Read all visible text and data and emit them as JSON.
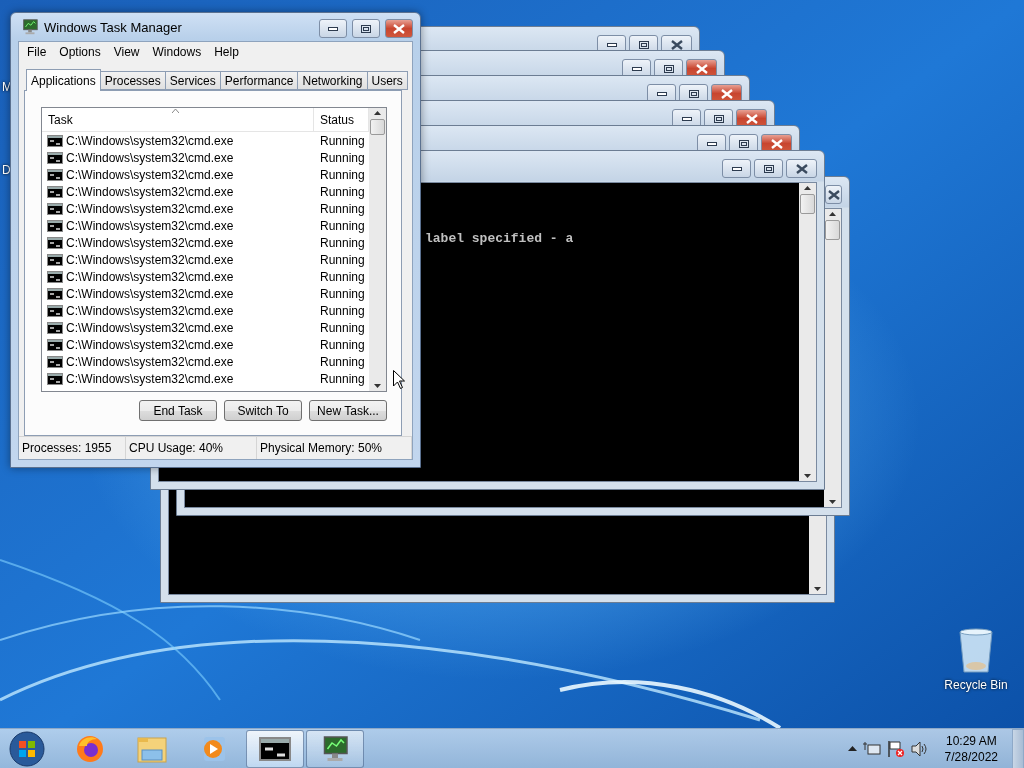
{
  "desktop_icons": [
    {
      "kind": "cut",
      "label": "M"
    },
    {
      "kind": "cut",
      "label": "D"
    },
    {
      "kind": "recycle_bin",
      "label": "Recycle Bin"
    }
  ],
  "console_windows": [
    {
      "close_highlighted": false
    },
    {
      "close_highlighted": false
    },
    {
      "close_highlighted": true
    },
    {
      "close_highlighted": true
    },
    {
      "close_highlighted": true
    },
    {
      "close_highlighted": true
    },
    {
      "close_highlighted": false,
      "text": "label specified - a"
    }
  ],
  "task_manager": {
    "title": "Windows Task Manager",
    "menu": [
      "File",
      "Options",
      "View",
      "Windows",
      "Help"
    ],
    "tabs": [
      {
        "label": "Applications",
        "selected": true
      },
      {
        "label": "Processes",
        "selected": false
      },
      {
        "label": "Services",
        "selected": false
      },
      {
        "label": "Performance",
        "selected": false
      },
      {
        "label": "Networking",
        "selected": false
      },
      {
        "label": "Users",
        "selected": false
      }
    ],
    "columns": [
      "Task",
      "Status"
    ],
    "rows": [
      {
        "task": "C:\\Windows\\system32\\cmd.exe",
        "status": "Running",
        "selected": false
      },
      {
        "task": "C:\\Windows\\system32\\cmd.exe",
        "status": "Running",
        "selected": false
      },
      {
        "task": "C:\\Windows\\system32\\cmd.exe",
        "status": "Running",
        "selected": false
      },
      {
        "task": "C:\\Windows\\system32\\cmd.exe",
        "status": "Running",
        "selected": false
      },
      {
        "task": "C:\\Windows\\system32\\cmd.exe",
        "status": "Running",
        "selected": false
      },
      {
        "task": "C:\\Windows\\system32\\cmd.exe",
        "status": "Running",
        "selected": false
      },
      {
        "task": "C:\\Windows\\system32\\cmd.exe",
        "status": "Running",
        "selected": false
      },
      {
        "task": "C:\\Windows\\system32\\cmd.exe",
        "status": "Running",
        "selected": false
      },
      {
        "task": "C:\\Windows\\system32\\cmd.exe",
        "status": "Running",
        "selected": false
      },
      {
        "task": "C:\\Windows\\system32\\cmd.exe",
        "status": "Running",
        "selected": false
      },
      {
        "task": "C:\\Windows\\system32\\cmd.exe",
        "status": "Running",
        "selected": false
      },
      {
        "task": "C:\\Windows\\system32\\cmd.exe",
        "status": "Running",
        "selected": false
      },
      {
        "task": "C:\\Windows\\system32\\cmd.exe",
        "status": "Running",
        "selected": false
      },
      {
        "task": "C:\\Windows\\system32\\cmd.exe",
        "status": "Running",
        "selected": false
      },
      {
        "task": "C:\\Windows\\system32\\cmd.exe",
        "status": "Running",
        "selected": false
      }
    ],
    "buttons": [
      "End Task",
      "Switch To",
      "New Task..."
    ],
    "status_bar": [
      "Processes: 1955",
      "CPU Usage: 40%",
      "Physical Memory: 50%"
    ]
  },
  "taskbar": {
    "items": [
      {
        "kind": "browser",
        "open": false,
        "selected": false
      },
      {
        "kind": "folder",
        "open": false,
        "selected": false
      },
      {
        "kind": "media",
        "open": false,
        "selected": false
      },
      {
        "kind": "console",
        "open": true,
        "selected": true
      },
      {
        "kind": "monitor",
        "open": true,
        "selected": false
      }
    ],
    "clock": {
      "time": "10:29 AM",
      "date": "7/28/2022"
    }
  }
}
